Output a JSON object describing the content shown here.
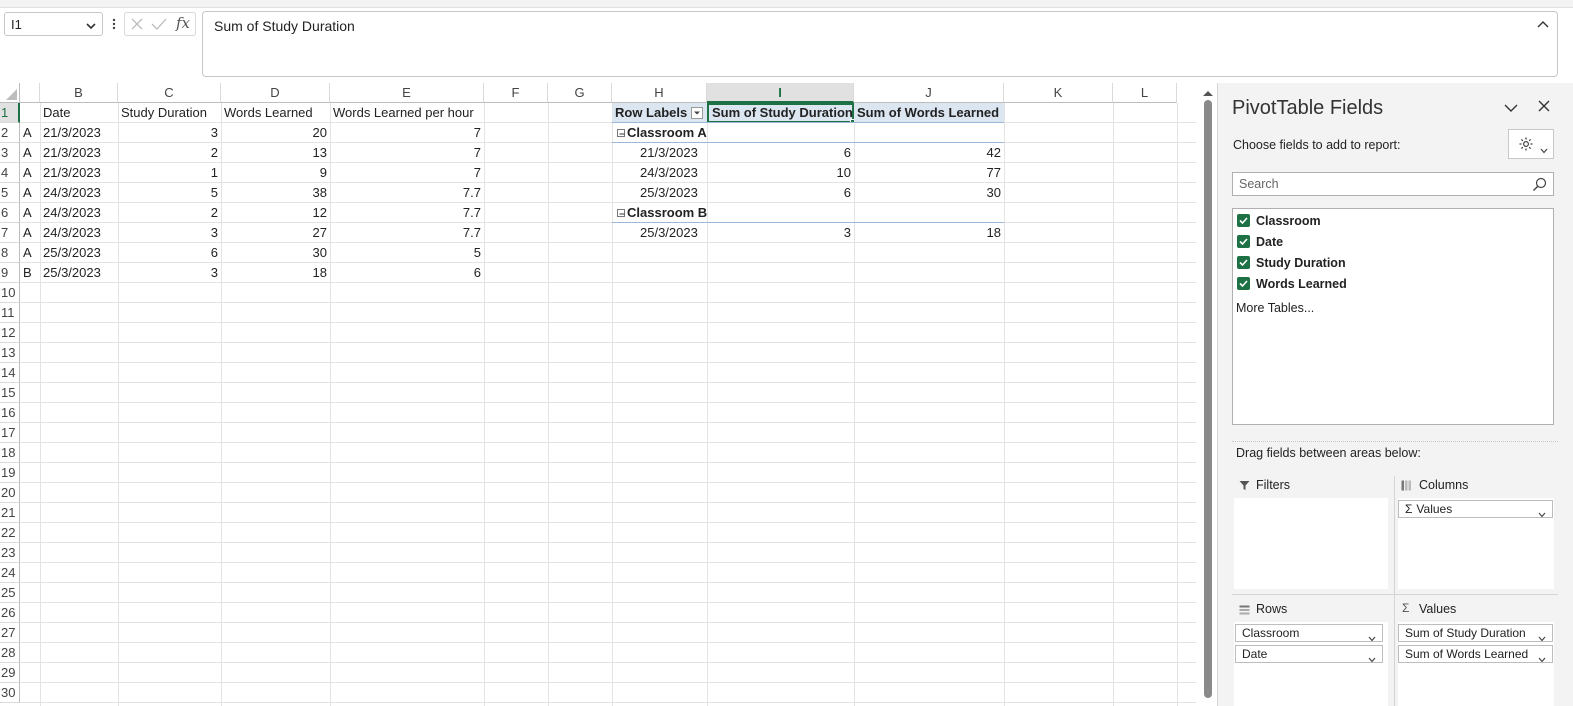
{
  "name_box": {
    "value": "I1"
  },
  "formula_bar": {
    "value": "Sum of Study Duration",
    "fx": "fx"
  },
  "columns": [
    "B",
    "C",
    "D",
    "E",
    "F",
    "G",
    "H",
    "I",
    "J",
    "K",
    "L"
  ],
  "rows": [
    "1",
    "2",
    "3",
    "4",
    "5",
    "6",
    "7",
    "8",
    "9",
    "10",
    "11",
    "12",
    "13",
    "14",
    "15",
    "16",
    "17",
    "18",
    "19",
    "20",
    "21",
    "22",
    "23",
    "24",
    "25",
    "26",
    "27",
    "28",
    "29",
    "30"
  ],
  "source_table": {
    "headers": [
      "Date",
      "Study Duration",
      "Words Learned",
      "Words Learned per hour"
    ],
    "rows": [
      {
        "classroom": "A",
        "date": "21/3/2023",
        "duration": "3",
        "words": "20",
        "per_hour": "7"
      },
      {
        "classroom": "A",
        "date": "21/3/2023",
        "duration": "2",
        "words": "13",
        "per_hour": "7"
      },
      {
        "classroom": "A",
        "date": "21/3/2023",
        "duration": "1",
        "words": "9",
        "per_hour": "7"
      },
      {
        "classroom": "A",
        "date": "24/3/2023",
        "duration": "5",
        "words": "38",
        "per_hour": "7.7"
      },
      {
        "classroom": "A",
        "date": "24/3/2023",
        "duration": "2",
        "words": "12",
        "per_hour": "7.7"
      },
      {
        "classroom": "A",
        "date": "24/3/2023",
        "duration": "3",
        "words": "27",
        "per_hour": "7.7"
      },
      {
        "classroom": "A",
        "date": "25/3/2023",
        "duration": "6",
        "words": "30",
        "per_hour": "5"
      },
      {
        "classroom": "B",
        "date": "25/3/2023",
        "duration": "3",
        "words": "18",
        "per_hour": "6"
      }
    ]
  },
  "pivot_table": {
    "headers": [
      "Row Labels",
      "Sum of Study Duration",
      "Sum of Words Learned"
    ],
    "rows": [
      {
        "label": "Classroom A",
        "type": "group",
        "duration": "",
        "words": ""
      },
      {
        "label": "21/3/2023",
        "type": "item",
        "duration": "6",
        "words": "42"
      },
      {
        "label": "24/3/2023",
        "type": "item",
        "duration": "10",
        "words": "77"
      },
      {
        "label": "25/3/2023",
        "type": "item",
        "duration": "6",
        "words": "30"
      },
      {
        "label": "Classroom B",
        "type": "group",
        "duration": "",
        "words": ""
      },
      {
        "label": "25/3/2023",
        "type": "item",
        "duration": "3",
        "words": "18"
      }
    ]
  },
  "pivot_panel": {
    "title": "PivotTable Fields",
    "subtitle": "Choose fields to add to report:",
    "search_placeholder": "Search",
    "fields": [
      "Classroom",
      "Date",
      "Study Duration",
      "Words Learned"
    ],
    "more_tables": "More Tables...",
    "drag_label": "Drag fields between areas below:",
    "filters_label": "Filters",
    "columns_label": "Columns",
    "rows_label": "Rows",
    "values_label": "Values",
    "columns_items": [
      "Values"
    ],
    "rows_items": [
      "Classroom",
      "Date"
    ],
    "values_items": [
      "Sum of Study Duration",
      "Sum of Words Learned"
    ]
  },
  "colors": {
    "accent": "#1e7145",
    "pivot_header": "#dce6f1"
  }
}
